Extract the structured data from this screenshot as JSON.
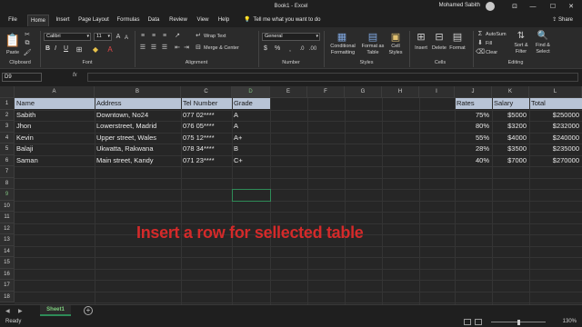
{
  "window": {
    "title": "Book1 - Excel",
    "user": "Mohamed Sabith",
    "controls": {
      "minimize": "—",
      "maximize": "☐",
      "close": "✕",
      "ribbon_display": "⊡"
    }
  },
  "menu": {
    "tabs": [
      "File",
      "Home",
      "Insert",
      "Page Layout",
      "Formulas",
      "Data",
      "Review",
      "View",
      "Help"
    ],
    "active": "Home",
    "tell_me": "Tell me what you want to do",
    "share": "Share"
  },
  "ribbon": {
    "clipboard": {
      "label": "Clipboard",
      "paste": "Paste"
    },
    "font": {
      "label": "Font",
      "name": "Calibri",
      "size": "11",
      "bold": "B",
      "italic": "I",
      "underline": "U"
    },
    "alignment": {
      "label": "Alignment",
      "wrap": "Wrap Text",
      "merge": "Merge & Center"
    },
    "number": {
      "label": "Number",
      "format": "General",
      "currency": "$",
      "percent": "%"
    },
    "styles": {
      "label": "Styles",
      "conditional": [
        "Conditional",
        "Formatting"
      ],
      "format_table": [
        "Format as",
        "Table"
      ],
      "cell_styles": [
        "Cell",
        "Styles"
      ]
    },
    "cells": {
      "label": "Cells",
      "insert": "Insert",
      "delete": "Delete",
      "format": "Format"
    },
    "editing": {
      "label": "Editing",
      "autosum": "AutoSum",
      "fill": "Fill",
      "clear": "Clear",
      "sort": [
        "Sort &",
        "Filter"
      ],
      "find": [
        "Find &",
        "Select"
      ]
    }
  },
  "formula_bar": {
    "name_box": "D9",
    "fx": "fx",
    "value": ""
  },
  "grid": {
    "columns": [
      "A",
      "B",
      "C",
      "D",
      "E",
      "F",
      "G",
      "H",
      "I",
      "J",
      "K",
      "L"
    ],
    "rows": [
      "1",
      "2",
      "3",
      "4",
      "5",
      "6",
      "7",
      "8",
      "9",
      "10",
      "11",
      "12",
      "13",
      "14",
      "15",
      "16",
      "17",
      "18"
    ],
    "selected_cell": "D9",
    "selected_column": "D",
    "selected_row": "9"
  },
  "table_left": {
    "headers": [
      "Name",
      "Address",
      "Tel Number",
      "Grade"
    ],
    "rows": [
      [
        "Sabith",
        "Downtown, No24",
        "077 02****",
        "A"
      ],
      [
        "Jhon",
        "Lowerstreet, Madrid",
        "076 05****",
        "A"
      ],
      [
        "Kevin",
        "Upper street, Wales",
        "075 12****",
        "A+"
      ],
      [
        "Balaji",
        "Ukwatta, Rakwana",
        "078 34****",
        "B"
      ],
      [
        "Saman",
        "Main street, Kandy",
        "071 23****",
        "C+"
      ]
    ]
  },
  "table_right": {
    "headers": [
      "Rates",
      "Salary",
      "Total"
    ],
    "rows": [
      [
        "75%",
        "$5000",
        "$250000"
      ],
      [
        "80%",
        "$3200",
        "$232000"
      ],
      [
        "55%",
        "$4000",
        "$240000"
      ],
      [
        "28%",
        "$3500",
        "$235000"
      ],
      [
        "40%",
        "$7000",
        "$270000"
      ]
    ]
  },
  "caption": "Insert a row for sellected table",
  "sheets": {
    "tabs": [
      "Sheet1"
    ],
    "add": "+"
  },
  "status": {
    "ready": "Ready",
    "zoom": "130%"
  },
  "colors": {
    "header_band": "#b8c4d6",
    "selection": "#2e8b57",
    "caption": "#d42a2a",
    "background": "#262626"
  }
}
